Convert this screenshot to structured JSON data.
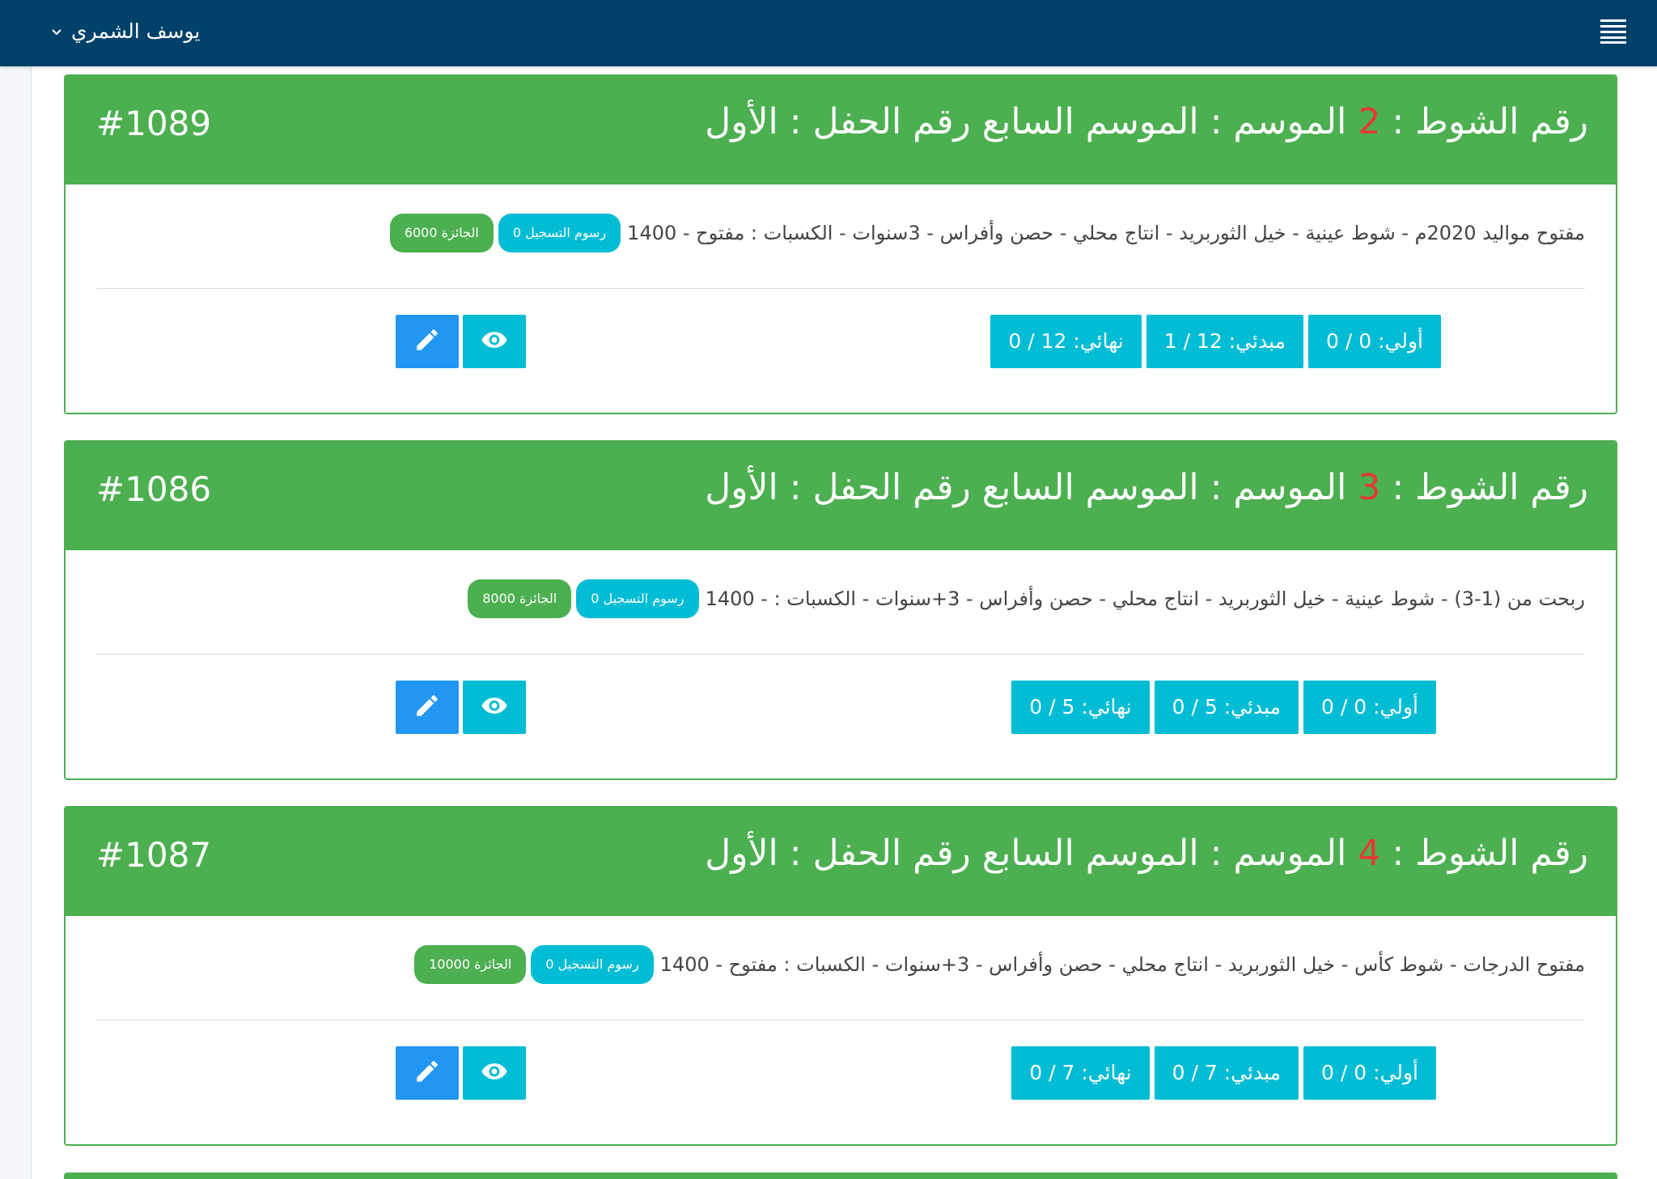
{
  "header": {
    "user_name": "يوسف الشمري"
  },
  "cards": [
    {
      "id": "#1089",
      "title_prefix": "رقم الشوط : ",
      "race_number": "2",
      "title_suffix": " الموسم : الموسم السابع رقم الحفل : الأول",
      "description": "مفتوح مواليد 2020م - شوط عينية - خيل الثوربريد - انتاج محلي - حصن وأفراس - 3سنوات - الكسبات : مفتوح - 1400",
      "fee_badge": "رسوم التسجيل 0",
      "prize_badge": "الجائزة 6000",
      "stats": [
        "أولي: 0 / 0",
        "مبدئي: 12 / 1",
        "نهائي: 12 / 0"
      ]
    },
    {
      "id": "#1086",
      "title_prefix": "رقم الشوط : ",
      "race_number": "3",
      "title_suffix": " الموسم : الموسم السابع رقم الحفل : الأول",
      "description": "ربحت من (1-3) - شوط عينية - خيل الثوربريد - انتاج محلي - حصن وأفراس - 3+سنوات - الكسبات : - 1400",
      "fee_badge": "رسوم التسجيل 0",
      "prize_badge": "الجائزة 8000",
      "stats": [
        "أولي: 0 / 0",
        "مبدئي: 5 / 0",
        "نهائي: 5 / 0"
      ]
    },
    {
      "id": "#1087",
      "title_prefix": "رقم الشوط : ",
      "race_number": "4",
      "title_suffix": " الموسم : الموسم السابع رقم الحفل : الأول",
      "description": "مفتوح الدرجات - شوط كأس - خيل الثوربريد - انتاج محلي - حصن وأفراس - 3+سنوات - الكسبات : مفتوح - 1400",
      "fee_badge": "رسوم التسجيل 0",
      "prize_badge": "الجائزة 10000",
      "stats": [
        "أولي: 0 / 0",
        "مبدئي: 7 / 0",
        "نهائي: 7 / 0"
      ]
    }
  ],
  "colors": {
    "topbar": "#00416a",
    "card_green": "#4caf50",
    "race_number_red": "#e53935",
    "cyan": "#00bcd4",
    "blue": "#2196f3"
  },
  "icons": {
    "menu": "hamburger-menu-icon",
    "user_dropdown": "chevron-down-icon",
    "edit": "pencil-icon",
    "view": "eye-icon"
  }
}
